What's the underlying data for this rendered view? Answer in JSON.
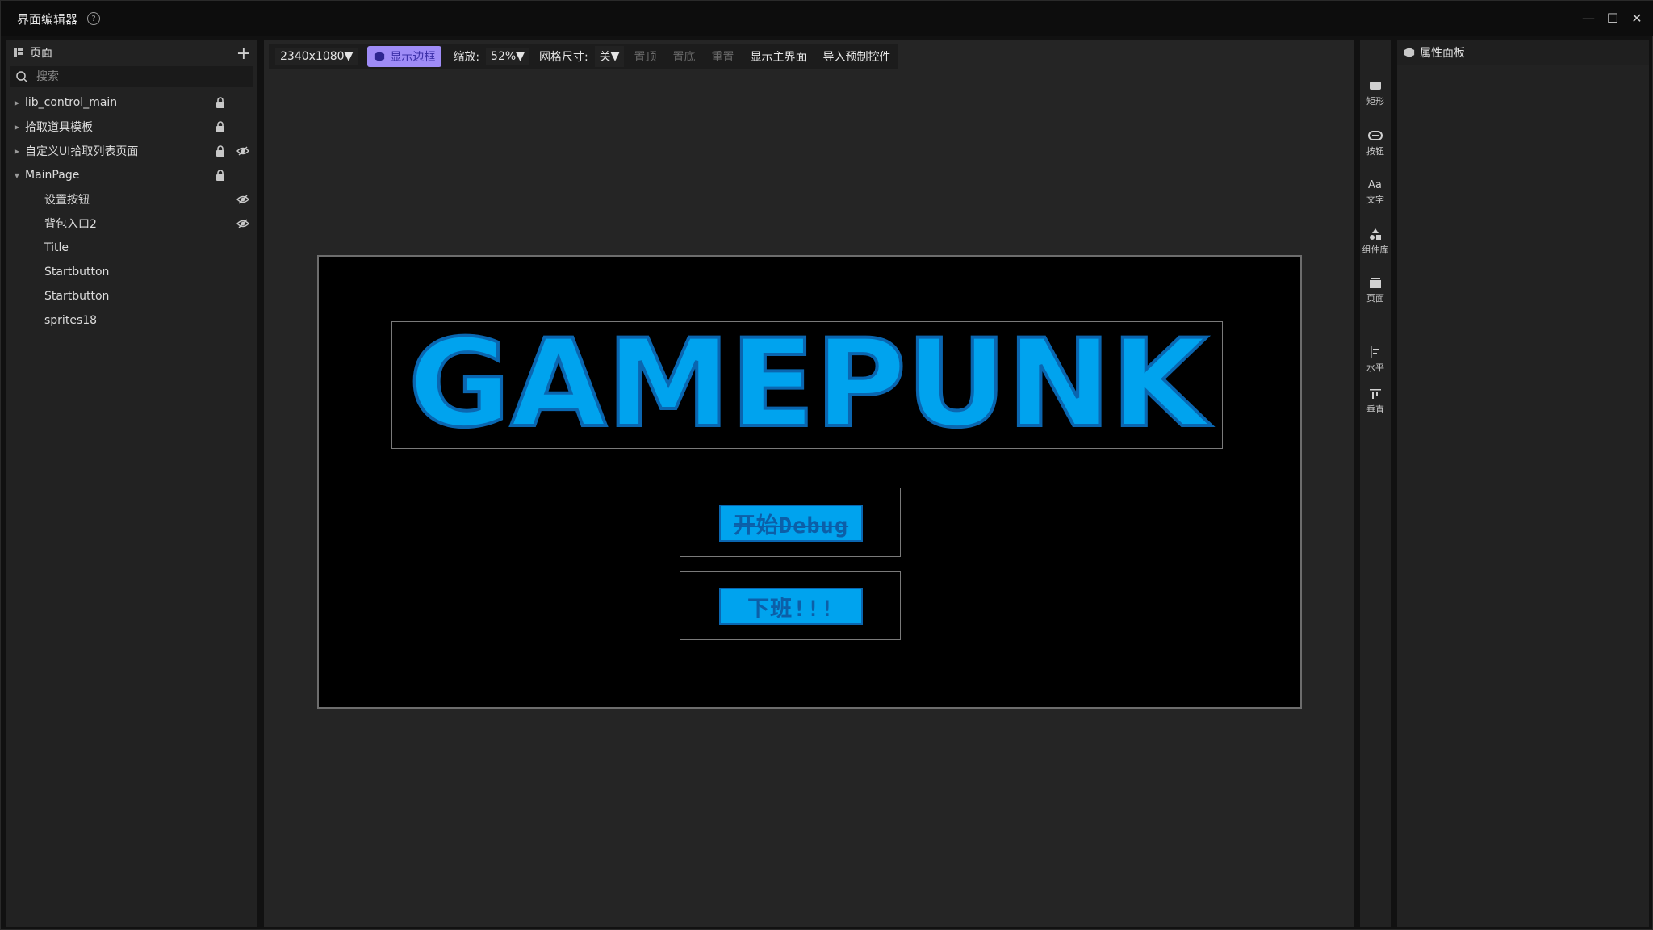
{
  "window": {
    "title": "界面编辑器",
    "help_symbol": "?",
    "minimize": "—",
    "maximize": "☐",
    "close": "✕"
  },
  "pages_panel": {
    "header": "页面",
    "add_symbol": "+",
    "search_placeholder": "搜索",
    "tree": [
      {
        "label": "lib_control_main",
        "lock": true,
        "eye": false,
        "expanded": false
      },
      {
        "label": "拾取道具模板",
        "lock": true,
        "eye": false,
        "expanded": false
      },
      {
        "label": "自定义UI拾取列表页面",
        "lock": true,
        "eye": true,
        "expanded": false
      },
      {
        "label": "MainPage",
        "lock": true,
        "eye": false,
        "expanded": true
      }
    ],
    "children": [
      {
        "label": "设置按钮",
        "eye": true
      },
      {
        "label": "背包入口2",
        "eye": true
      },
      {
        "label": "Title",
        "eye": false
      },
      {
        "label": "Startbutton",
        "eye": false
      },
      {
        "label": "Startbutton",
        "eye": false
      },
      {
        "label": "sprites18",
        "eye": false
      }
    ]
  },
  "toolbar": {
    "resolution": "2340x1080",
    "show_border": "显示边框",
    "zoom_label": "缩放:",
    "zoom_value": "52%",
    "grid_label": "网格尺寸:",
    "grid_value": "关",
    "bring_top": "置顶",
    "send_bottom": "置底",
    "reset": "重置",
    "show_main": "显示主界面",
    "import_prefab": "导入预制控件"
  },
  "artboard": {
    "title_text": "GAMEPUNK",
    "button1": "开始Debug",
    "button2": "下班!!!",
    "accent": "#00a3ee"
  },
  "tools": [
    {
      "label": "矩形",
      "icon": "rectangle-icon"
    },
    {
      "label": "按钮",
      "icon": "button-icon"
    },
    {
      "label": "文字",
      "icon": "text-icon"
    },
    {
      "label": "组件库",
      "icon": "shapes-icon"
    },
    {
      "label": "页面",
      "icon": "page-icon"
    },
    {
      "label": "水平",
      "icon": "align-horizontal-icon"
    },
    {
      "label": "垂直",
      "icon": "align-vertical-icon"
    }
  ],
  "props_panel": {
    "header": "属性面板"
  }
}
